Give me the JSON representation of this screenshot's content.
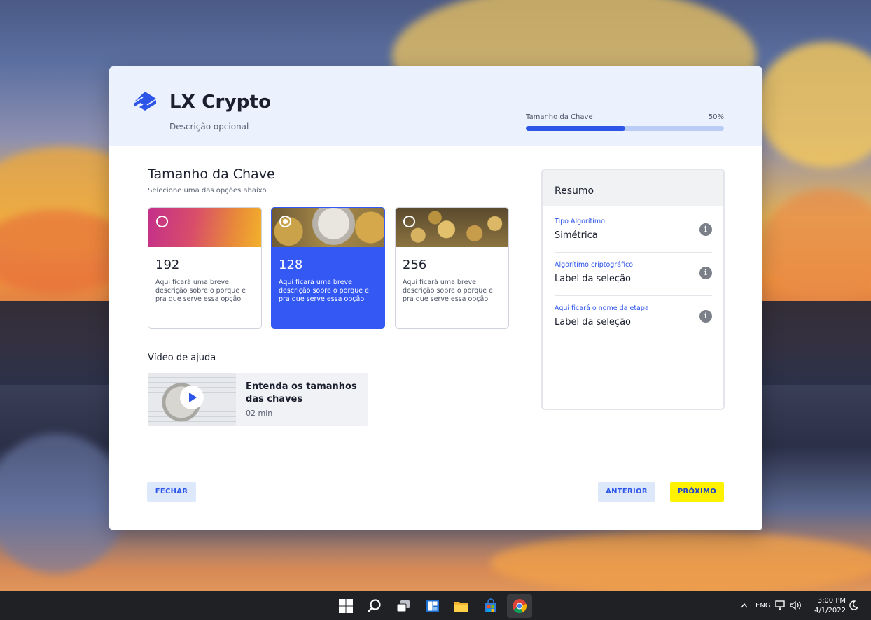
{
  "app": {
    "title": "LX Crypto",
    "subtitle": "Descrição opcional"
  },
  "progress": {
    "label": "Tamanho da Chave",
    "percent_text": "50%",
    "value": 0.5
  },
  "section": {
    "title": "Tamanho da Chave",
    "subtitle": "Selecione uma das opções abaixo"
  },
  "options": [
    {
      "value": "192",
      "description": "Aqui ficará uma breve descrição sobre o porque e pra que serve essa opção.",
      "selected": false
    },
    {
      "value": "128",
      "description": "Aqui ficará uma breve descrição sobre o porque e pra que serve essa opção.",
      "selected": true
    },
    {
      "value": "256",
      "description": "Aqui ficará uma breve descrição sobre o porque e pra que serve essa opção.",
      "selected": false
    }
  ],
  "video": {
    "section_title": "Vídeo de ajuda",
    "title": "Entenda os tamanhos das chaves",
    "duration": "02 min"
  },
  "summary": {
    "title": "Resumo",
    "items": [
      {
        "label": "Tipo Algorítimo",
        "value": "Simétrica"
      },
      {
        "label": "Algorítimo criptográfico",
        "value": "Label da seleção"
      },
      {
        "label": "Aqui ficará o nome da etapa",
        "value": "Label da seleção"
      }
    ]
  },
  "buttons": {
    "close": "FECHAR",
    "previous": "ANTERIOR",
    "next": "PRÓXIMO"
  },
  "colors": {
    "accent": "#2d55e8",
    "selected_card": "#3358f4",
    "next_button": "#fff200",
    "header_bg": "#ebf1fd"
  },
  "taskbar": {
    "language": "ENG",
    "time": "3:00 PM",
    "date": "4/1/2022",
    "icons": [
      "windows-start-icon",
      "search-icon",
      "task-view-icon",
      "widgets-icon",
      "file-explorer-icon",
      "store-icon",
      "chrome-icon"
    ]
  }
}
